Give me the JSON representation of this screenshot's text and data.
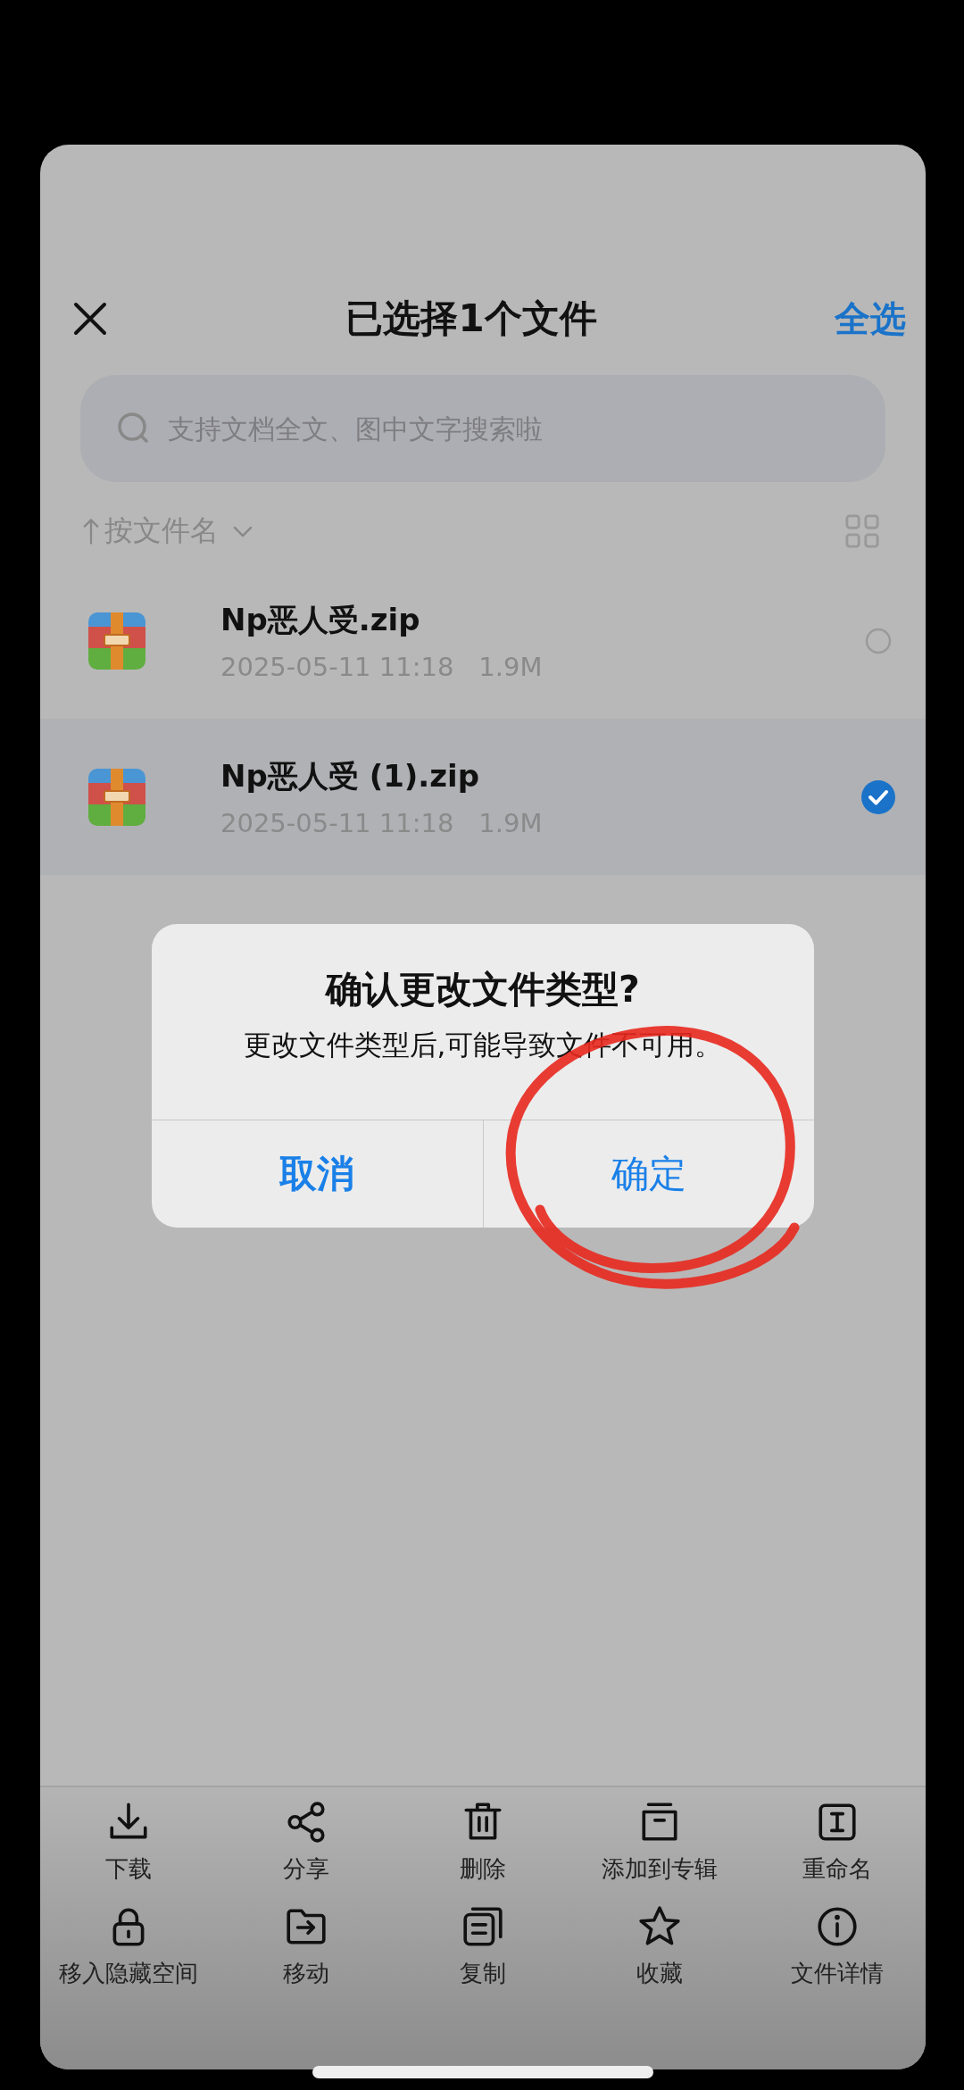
{
  "header": {
    "title": "已选择1个文件",
    "select_all": "全选"
  },
  "search": {
    "placeholder": "支持文档全文、图中文字搜索啦"
  },
  "sort": {
    "label": "按文件名"
  },
  "files": [
    {
      "name": "Np恶人受.zip",
      "date": "2025-05-11 11:18",
      "size": "1.9M",
      "selected": false
    },
    {
      "name": "Np恶人受 (1).zip",
      "date": "2025-05-11 11:18",
      "size": "1.9M",
      "selected": true
    }
  ],
  "dialog": {
    "title": "确认更改文件类型?",
    "message": "更改文件类型后,可能导致文件不可用。",
    "buttons": [
      {
        "label": "取消",
        "kind": "cancel"
      },
      {
        "label": "确定",
        "kind": "confirm"
      }
    ]
  },
  "actions": [
    {
      "label": "下载"
    },
    {
      "label": "分享"
    },
    {
      "label": "删除"
    },
    {
      "label": "添加到专辑"
    },
    {
      "label": "重命名"
    },
    {
      "label": "移入隐藏空间"
    },
    {
      "label": "移动"
    },
    {
      "label": "复制"
    },
    {
      "label": "收藏"
    },
    {
      "label": "文件详情"
    }
  ]
}
